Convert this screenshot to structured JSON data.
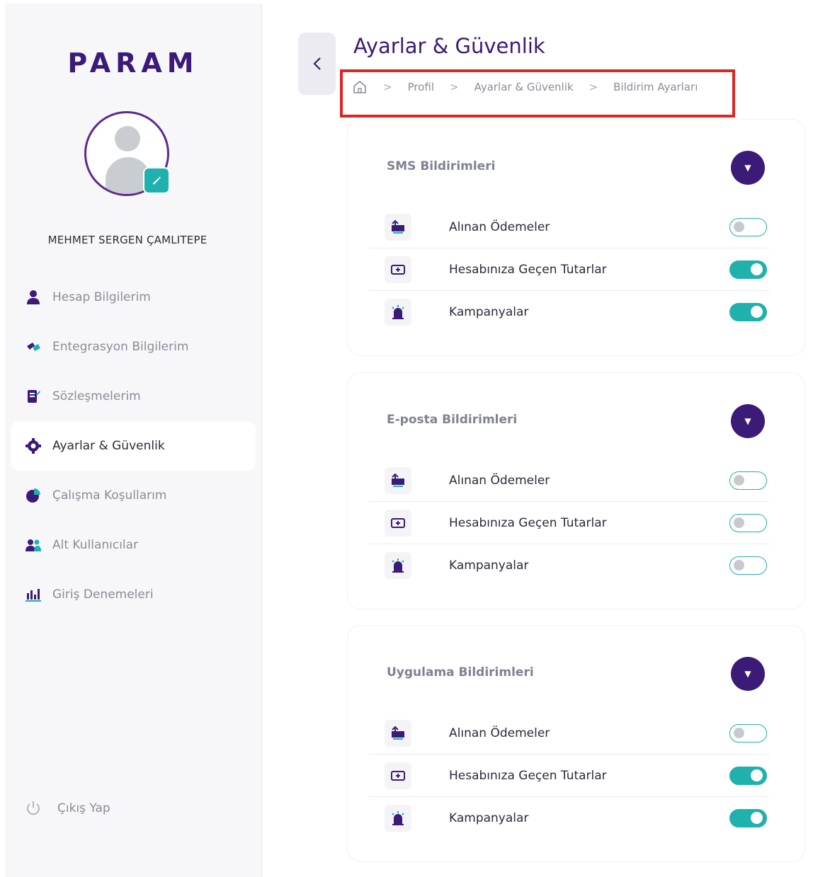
{
  "sidebar": {
    "logo": "PARAM",
    "user_name": "MEHMET SERGEN ÇAMLITEPE",
    "items": [
      {
        "label": "Hesap Bilgilerim",
        "icon": "user-icon"
      },
      {
        "label": "Entegrasyon Bilgilerim",
        "icon": "integration-icon"
      },
      {
        "label": "Sözleşmelerim",
        "icon": "contract-icon"
      },
      {
        "label": "Ayarlar & Güvenlik",
        "icon": "gear-icon",
        "active": true
      },
      {
        "label": "Çalışma Koşullarım",
        "icon": "pie-chart-icon"
      },
      {
        "label": "Alt Kullanıcılar",
        "icon": "users-icon"
      },
      {
        "label": "Giriş Denemeleri",
        "icon": "bar-chart-icon"
      }
    ],
    "logout": "Çıkış Yap"
  },
  "header": {
    "title": "Ayarlar & Güvenlik",
    "breadcrumb": [
      "Profil",
      "Ayarlar & Güvenlik",
      "Bildirim Ayarları"
    ]
  },
  "sections": [
    {
      "title": "SMS Bildirimleri",
      "rows": [
        {
          "label": "Alınan Ödemeler",
          "enabled": false
        },
        {
          "label": "Hesabınıza Geçen Tutarlar",
          "enabled": true
        },
        {
          "label": "Kampanyalar",
          "enabled": true
        }
      ]
    },
    {
      "title": "E-posta Bildirimleri",
      "rows": [
        {
          "label": "Alınan Ödemeler",
          "enabled": false
        },
        {
          "label": "Hesabınıza Geçen Tutarlar",
          "enabled": false
        },
        {
          "label": "Kampanyalar",
          "enabled": false
        }
      ]
    },
    {
      "title": "Uygulama Bildirimleri",
      "rows": [
        {
          "label": "Alınan Ödemeler",
          "enabled": false
        },
        {
          "label": "Hesabınıza Geçen Tutarlar",
          "enabled": true
        },
        {
          "label": "Kampanyalar",
          "enabled": true
        }
      ]
    }
  ],
  "colors": {
    "brand": "#3b1a78",
    "accent": "#1fb1ad",
    "highlight": "#e02424"
  }
}
